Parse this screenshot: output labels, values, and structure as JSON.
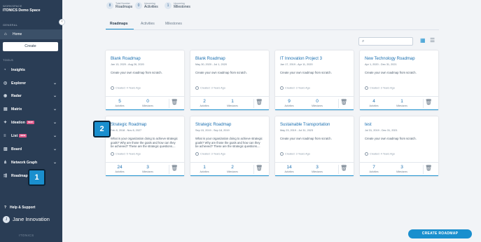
{
  "sidebar": {
    "workspace_label": "WORKSPACE",
    "workspace_name": "ITONICS Demo Space",
    "general_label": "GENERAL",
    "home_label": "Home",
    "create_label": "Create",
    "tools_label": "TOOLS",
    "items": [
      {
        "label": "Insights",
        "icon": "insights-icon",
        "chevron": false,
        "new": false
      },
      {
        "label": "Explorer",
        "icon": "explorer-icon",
        "chevron": true,
        "new": false
      },
      {
        "label": "Radar",
        "icon": "radar-icon",
        "chevron": true,
        "new": false
      },
      {
        "label": "Matrix",
        "icon": "matrix-icon",
        "chevron": true,
        "new": false
      },
      {
        "label": "Ideation",
        "icon": "ideation-icon",
        "chevron": true,
        "new": true
      },
      {
        "label": "List",
        "icon": "list-icon",
        "chevron": true,
        "new": true
      },
      {
        "label": "Board",
        "icon": "board-icon",
        "chevron": true,
        "new": false
      },
      {
        "label": "Network Graph",
        "icon": "network-graph-icon",
        "chevron": true,
        "new": false
      },
      {
        "label": "Roadmap",
        "icon": "roadmap-icon",
        "chevron": false,
        "new": false
      }
    ],
    "new_badge": "NEW",
    "help_label": "Help & Support",
    "user_initial": "J",
    "user_name": "Jane Innovation",
    "logo_text": "ITONICS"
  },
  "markers": {
    "one": "1",
    "two": "2"
  },
  "stats": [
    {
      "value": "8",
      "label": "Total Number",
      "name": "Roadmaps"
    },
    {
      "value": "0",
      "label": "Upcoming",
      "name": "Activities"
    },
    {
      "value": "1",
      "label": "Upcoming",
      "name": "Milestones"
    }
  ],
  "tabs": [
    "Roadmaps",
    "Activities",
    "Milestones"
  ],
  "search": {
    "placeholder": ""
  },
  "footer_labels": {
    "activities": "Activities",
    "milestones": "Milestones"
  },
  "cards": [
    {
      "title": "Blank Roadmap",
      "dates": "Jan 13, 2020 - Aug 26, 2020",
      "desc": "Create your own roadmap from scratch.",
      "created": "Created: 4 Years Ago",
      "activities": "5",
      "milestones": "0"
    },
    {
      "title": "Blank Roadmap",
      "dates": "May 30, 2020 - Jul 1, 2020",
      "desc": "Create your own roadmap from scratch.",
      "created": "Created: 3 Years Ago",
      "activities": "2",
      "milestones": "1"
    },
    {
      "title": "IT Innovation Project 3",
      "dates": "Jan 17, 2019 - Apr 11, 2020",
      "desc": "Create your own roadmap from scratch.",
      "created": "Created: 3 Years Ago",
      "activities": "9",
      "milestones": "0"
    },
    {
      "title": "New Technology Roadmap",
      "dates": "Apr 1, 2020 - Dec 31, 2021",
      "desc": "Create your own roadmap from scratch.",
      "created": "Created: 3 Years Ago",
      "activities": "4",
      "milestones": "1"
    },
    {
      "title": "Strategic Roadmap",
      "dates": "Feb 8, 2018 - Nov 8, 2027",
      "desc": "What is your organization doing to achieve strategic goals? Why are those the goals and how can they be achieved? These are the strategic questions....",
      "created": "Created: 5 Years Ago",
      "activities": "24",
      "milestones": "3"
    },
    {
      "title": "Strategic Roadmap",
      "dates": "Sep 15, 2019 - Sep 18, 2019",
      "desc": "What is your organization doing to achieve strategic goals? Why are those the goals and how can they be achieved? These are the strategic questions....",
      "created": "Created: 3 Years Ago",
      "activities": "1",
      "milestones": "2"
    },
    {
      "title": "Sustainable Transportation",
      "dates": "May 23, 2019 - Jul 31, 2023",
      "desc": "Create your own roadmap from scratch.",
      "created": "Created: 3 Years Ago",
      "activities": "14",
      "milestones": "3"
    },
    {
      "title": "test",
      "dates": "Jul 31, 2019 - Dec 31, 2021",
      "desc": "Create your own roadmap from scratch.",
      "created": "Created: 4 Years Ago",
      "activities": "7",
      "milestones": "3"
    }
  ],
  "create_roadmap_label": "CREATE ROADMAP"
}
